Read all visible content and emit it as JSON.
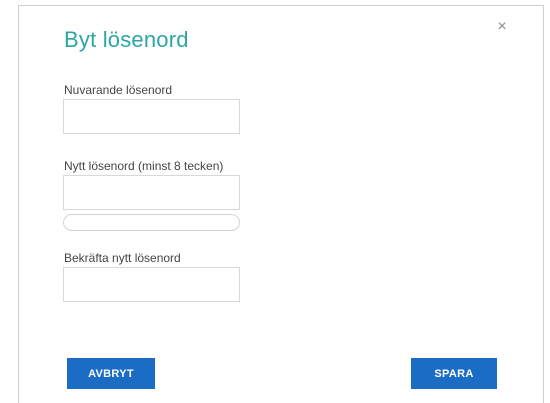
{
  "dialog": {
    "title": "Byt lösenord",
    "close_symbol": "×",
    "close_icon": "close-icon"
  },
  "fields": {
    "current_password": {
      "label": "Nuvarande lösenord",
      "value": "",
      "placeholder": ""
    },
    "new_password": {
      "label": "Nytt lösenord (minst 8 tecken)",
      "value": "",
      "placeholder": ""
    },
    "confirm_password": {
      "label": "Bekräfta nytt lösenord",
      "value": "",
      "placeholder": ""
    }
  },
  "strength": {
    "level": 0
  },
  "buttons": {
    "cancel_label": "AVBRYT",
    "save_label": "SPARA"
  },
  "colors": {
    "title": "#2aa7a4",
    "button": "#1a6cc4"
  }
}
